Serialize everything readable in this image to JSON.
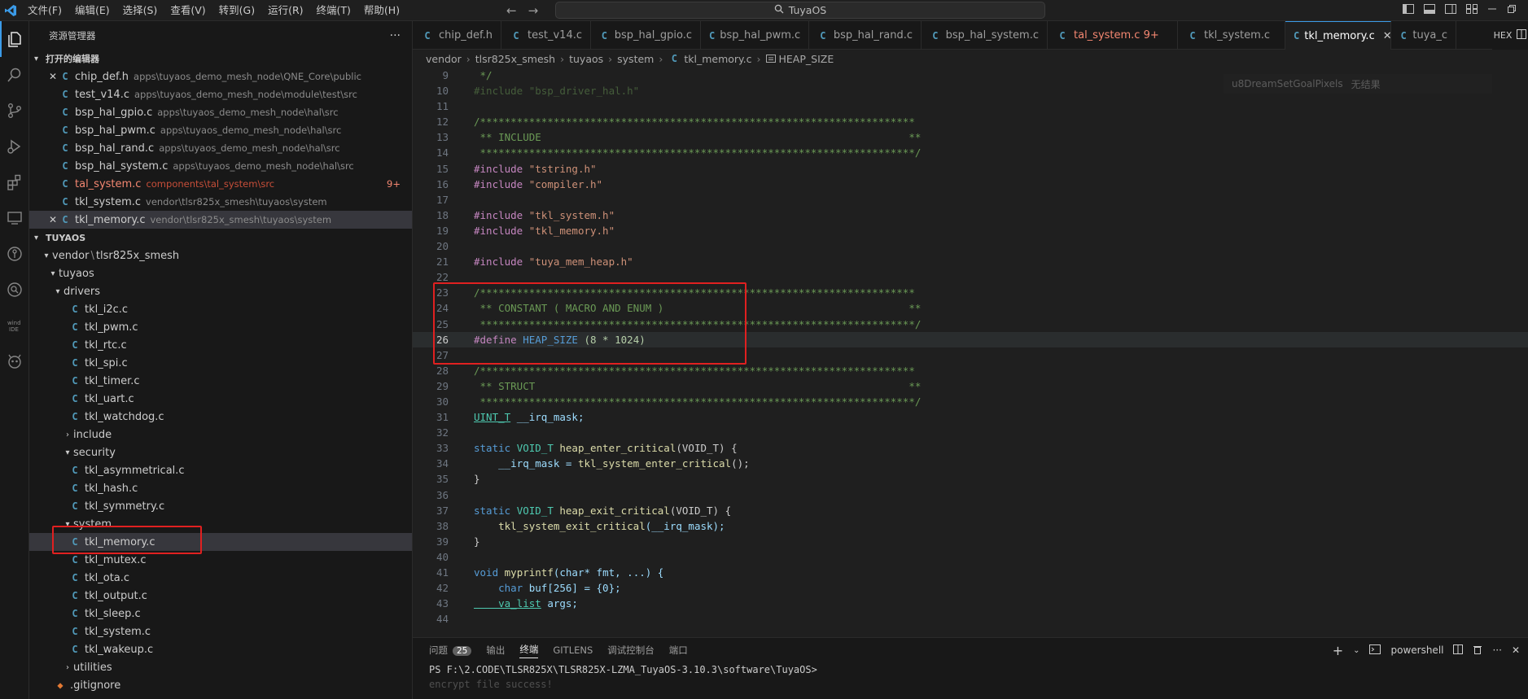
{
  "titlebar": {
    "logo": "✕",
    "menus": [
      "文件(F)",
      "编辑(E)",
      "选择(S)",
      "查看(V)",
      "转到(G)",
      "运行(R)",
      "终端(T)",
      "帮助(H)"
    ],
    "search_text": "TuyaOS",
    "back_arrow": "←",
    "forward_arrow": "→"
  },
  "sidebar": {
    "title": "资源管理器",
    "more": "···",
    "open_editors_label": "打开的编辑器",
    "open_editors": [
      {
        "name": "chip_def.h",
        "path": "apps\\tuyaos_demo_mesh_node\\QNE_Core\\public",
        "close": "✕"
      },
      {
        "name": "test_v14.c",
        "path": "apps\\tuyaos_demo_mesh_node\\module\\test\\src"
      },
      {
        "name": "bsp_hal_gpio.c",
        "path": "apps\\tuyaos_demo_mesh_node\\hal\\src"
      },
      {
        "name": "bsp_hal_pwm.c",
        "path": "apps\\tuyaos_demo_mesh_node\\hal\\src"
      },
      {
        "name": "bsp_hal_rand.c",
        "path": "apps\\tuyaos_demo_mesh_node\\hal\\src"
      },
      {
        "name": "bsp_hal_system.c",
        "path": "apps\\tuyaos_demo_mesh_node\\hal\\src"
      },
      {
        "name": "tal_system.c",
        "path": "components\\tal_system\\src",
        "badge": "9+"
      },
      {
        "name": "tkl_system.c",
        "path": "vendor\\tlsr825x_smesh\\tuyaos\\system"
      },
      {
        "name": "tkl_memory.c",
        "path": "vendor\\tlsr825x_smesh\\tuyaos\\system",
        "close": "✕"
      }
    ],
    "workspace_label": "TUYAOS",
    "tree": {
      "vendor": "vendor",
      "vendor_sub": "tlsr825x_smesh",
      "tuyaos": "tuyaos",
      "drivers": "drivers",
      "drivers_files": [
        "tkl_i2c.c",
        "tkl_pwm.c",
        "tkl_rtc.c",
        "tkl_spi.c",
        "tkl_timer.c",
        "tkl_uart.c",
        "tkl_watchdog.c"
      ],
      "include": "include",
      "security": "security",
      "security_files": [
        "tkl_asymmetrical.c",
        "tkl_hash.c",
        "tkl_symmetry.c"
      ],
      "system": "system",
      "system_files": [
        "tkl_memory.c",
        "tkl_mutex.c",
        "tkl_ota.c",
        "tkl_output.c",
        "tkl_sleep.c",
        "tkl_system.c",
        "tkl_wakeup.c"
      ],
      "utilities": "utilities",
      "gitignore": ".gitignore"
    }
  },
  "tabs": [
    {
      "name": "chip_def.h"
    },
    {
      "name": "test_v14.c"
    },
    {
      "name": "bsp_hal_gpio.c"
    },
    {
      "name": "bsp_hal_pwm.c"
    },
    {
      "name": "bsp_hal_rand.c"
    },
    {
      "name": "bsp_hal_system.c"
    },
    {
      "name": "tal_system.c 9+"
    },
    {
      "name": "tkl_system.c"
    },
    {
      "name": "tkl_memory.c",
      "close": "✕"
    },
    {
      "name": "tuya_c"
    }
  ],
  "tab_hex": "HEX",
  "breadcrumb": [
    "vendor",
    "tlsr825x_smesh",
    "tuyaos",
    "system",
    "tkl_memory.c",
    "HEAP_SIZE"
  ],
  "editor": {
    "find_text": "u8DreamSetGoalPixels",
    "find_result": "无结果",
    "line_numbers": [
      "9",
      "10",
      "11",
      "12",
      "13",
      "14",
      "15",
      "16",
      "17",
      "18",
      "19",
      "20",
      "21",
      "22",
      "23",
      "24",
      "25",
      "26",
      "27",
      "28",
      "29",
      "30",
      "31",
      "32",
      "33",
      "34",
      "35",
      "36",
      "37",
      "38",
      "39",
      "40",
      "41",
      "42",
      "43",
      "44"
    ],
    "lines": {
      "l9": " */",
      "l10": "#include \"bsp_driver_hal.h\"",
      "l12": "/***********************************************************************",
      "l13": " ** INCLUDE                                                            **",
      "l14": " ***********************************************************************/",
      "l15a": "#include",
      "l15b": "\"tstring.h\"",
      "l16a": "#include",
      "l16b": "\"compiler.h\"",
      "l18a": "#include",
      "l18b": "\"tkl_system.h\"",
      "l19a": "#include",
      "l19b": "\"tkl_memory.h\"",
      "l21a": "#include",
      "l21b": "\"tuya_mem_heap.h\"",
      "l23": "/***********************************************************************",
      "l24": " ** CONSTANT ( MACRO AND ENUM )                                        **",
      "l25": " ***********************************************************************/",
      "l26a": "#define",
      "l26b": "HEAP_SIZE",
      "l26c": "(8 * 1024)",
      "l28": "/***********************************************************************",
      "l29": " ** STRUCT                                                             **",
      "l30": " ***********************************************************************/",
      "l31a": "UINT_T",
      "l31b": "__irq_mask;",
      "l33a": "static",
      "l33b": "VOID_T",
      "l33c": "heap_enter_critical",
      "l33d": "(VOID_T) {",
      "l34a": "    __irq_mask = ",
      "l34b": "tkl_system_enter_critical",
      "l34c": "();",
      "l35": "}",
      "l37a": "static",
      "l37b": "VOID_T",
      "l37c": "heap_exit_critical",
      "l37d": "(VOID_T) {",
      "l38a": "    ",
      "l38b": "tkl_system_exit_critical",
      "l38c": "(__irq_mask);",
      "l39": "}",
      "l41a": "void",
      "l41b": "myprintf",
      "l41c": "(char* fmt, ...) {",
      "l42a": "    char",
      "l42b": " buf[256] = {0};",
      "l43a": "    va_list",
      "l43b": " args;"
    }
  },
  "panel": {
    "tabs": [
      "问题",
      "输出",
      "终端",
      "GITLENS",
      "调试控制台",
      "端口"
    ],
    "problems_count": "25",
    "shell": "powershell",
    "prompt": "PS F:\\2.CODE\\TLSR825X\\TLSR825X-LZMA_TuyaOS-3.10.3\\software\\TuyaOS>",
    "ghost_line": "encrypt file success!"
  },
  "colors": {
    "accent": "#3b9be8",
    "highlight_box": "#e02020",
    "error": "#f48771"
  }
}
